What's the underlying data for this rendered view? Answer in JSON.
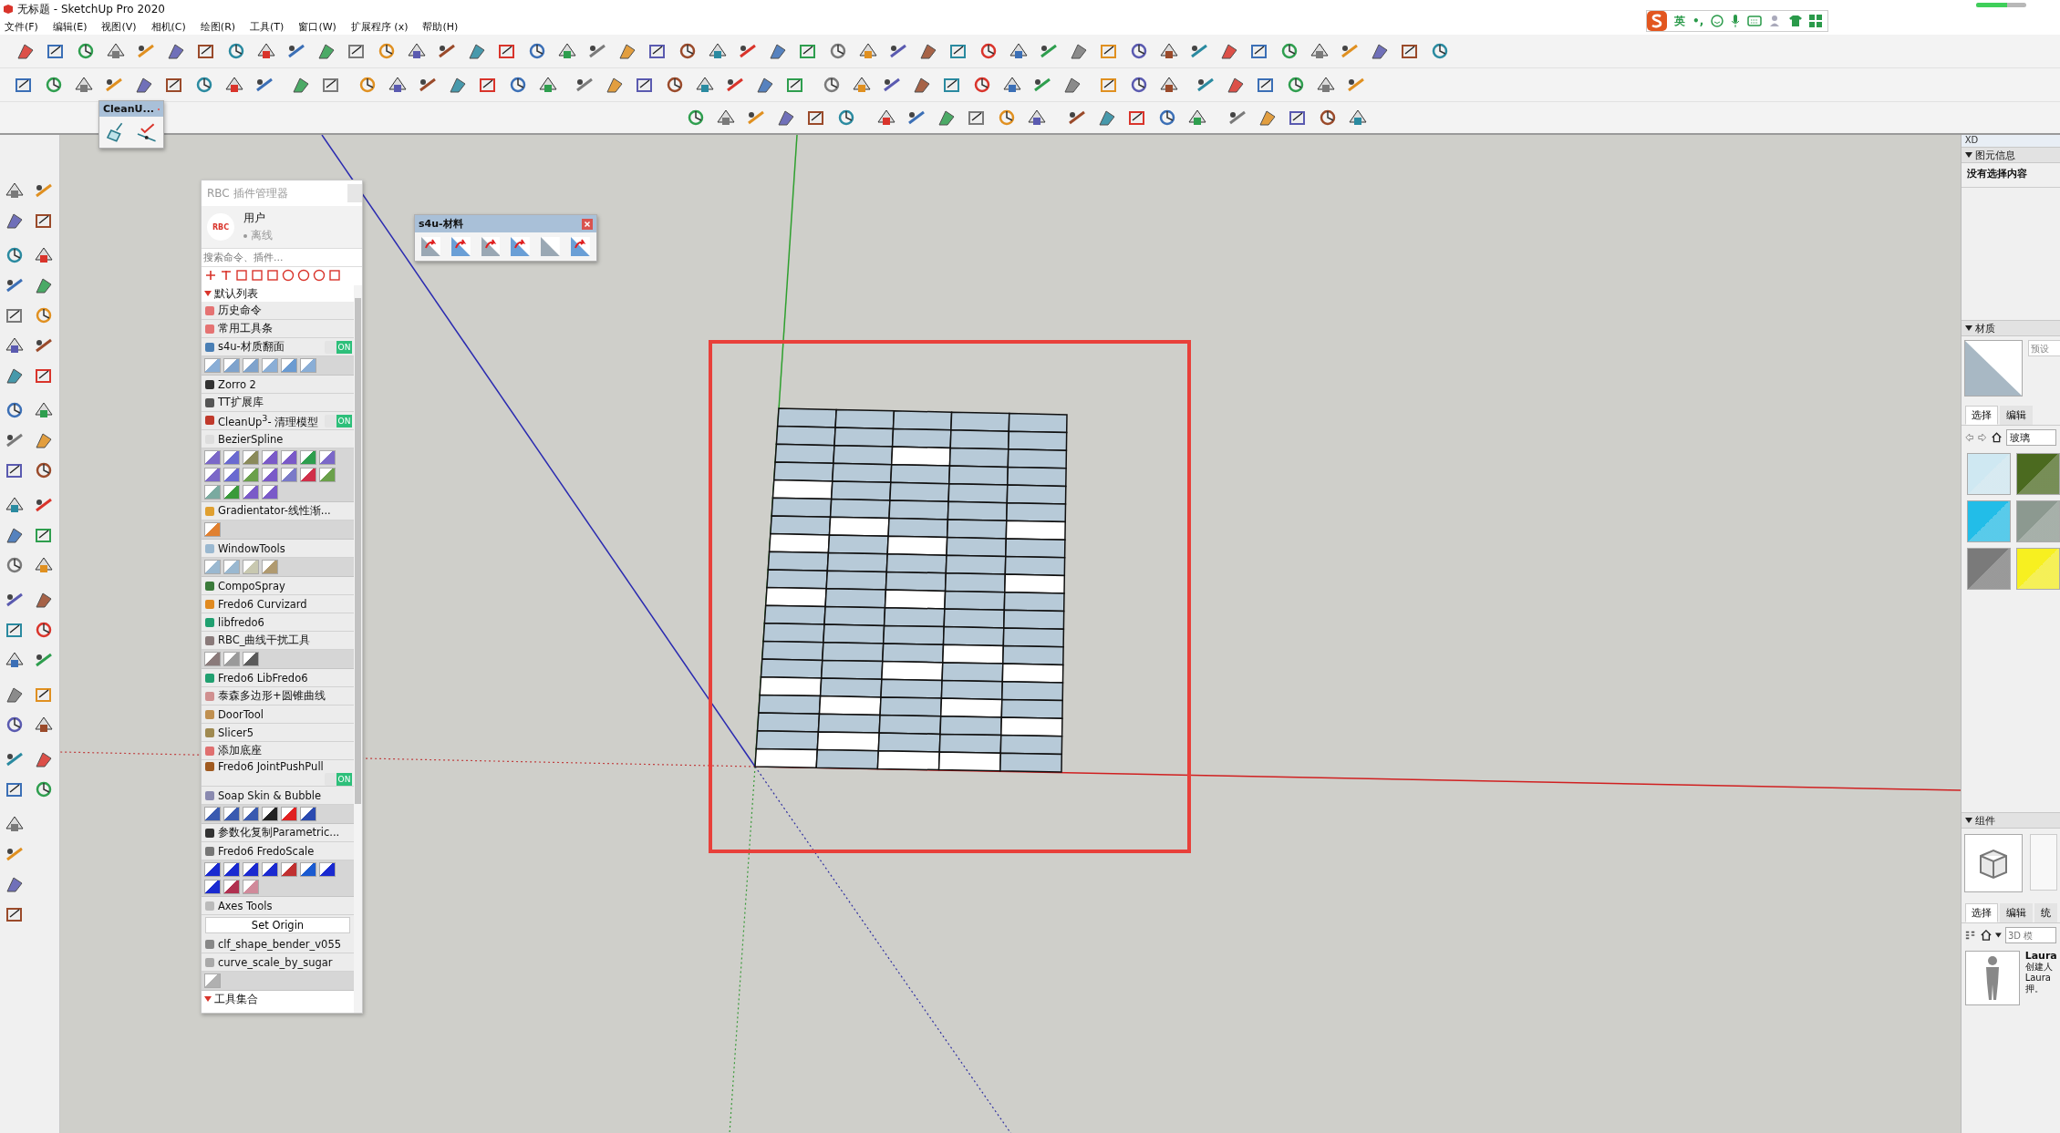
{
  "window": {
    "title": "无标题 - SketchUp Pro 2020"
  },
  "menu": [
    "文件(F)",
    "编辑(E)",
    "视图(V)",
    "相机(C)",
    "绘图(R)",
    "工具(T)",
    "窗口(W)",
    "扩展程序 (x)",
    "帮助(H)"
  ],
  "ime_bar": {
    "label": "英",
    "punct": "•,"
  },
  "status_meter": {
    "level": 0.62
  },
  "cleanup_toolbar": {
    "title": "CleanU..."
  },
  "s4u_toolbar": {
    "title": "s4u-材料"
  },
  "plugin_manager": {
    "title": "RBC 插件管理器",
    "logo": "RBC",
    "user": "用户",
    "status": "离线",
    "search": {
      "placeholder": "搜索命令、插件..."
    },
    "sections": [
      {
        "label": "默认列表",
        "expanded": true,
        "items": [
          {
            "kind": "plugin",
            "label": "历史命令",
            "color": "#e57373"
          },
          {
            "kind": "plugin",
            "label": "常用工具条",
            "color": "#e57373"
          },
          {
            "kind": "plugin",
            "label": "s4u-材质翻面",
            "color": "#4a7fb5",
            "toggle": {
              "on": true,
              "text": "ON"
            }
          },
          {
            "kind": "icons",
            "icons": [
              {
                "color": "#8aaed6"
              },
              {
                "color": "#7fa3cc"
              },
              {
                "color": "#7fa3cc"
              },
              {
                "color": "#8aaed6"
              },
              {
                "color": "#6b9bd1"
              },
              {
                "color": "#8aaed6"
              }
            ]
          },
          {
            "kind": "plugin",
            "label": "Zorro 2",
            "color": "#333333"
          },
          {
            "kind": "plugin",
            "label": "TT扩展库",
            "color": "#555555"
          },
          {
            "kind": "plugin",
            "label": "CleanUp$^{3}$- 清理模型",
            "color": "#c0392b",
            "toggle": {
              "on": true,
              "text": "ON"
            }
          },
          {
            "kind": "plugin",
            "label": "BezierSpline",
            "color": "#dddddd"
          },
          {
            "kind": "icons",
            "icons": [
              {
                "color": "#7b68c8"
              },
              {
                "color": "#6a6ad0"
              },
              {
                "color": "#8a8a5a"
              },
              {
                "color": "#7a5ac8"
              },
              {
                "color": "#7a5ac8"
              },
              {
                "color": "#2e9e4e"
              },
              {
                "color": "#7b68c8"
              },
              {
                "color": "#7b68c8"
              },
              {
                "color": "#6a6ad0"
              },
              {
                "color": "#6aa04a"
              },
              {
                "color": "#7a5ac8"
              },
              {
                "color": "#7a7ac8"
              },
              {
                "color": "#d0304a"
              },
              {
                "color": "#6aa04a"
              },
              {
                "color": "#7aaaa0"
              },
              {
                "color": "#3a9a3a"
              },
              {
                "color": "#7a5ac8"
              },
              {
                "color": "#7a5ac8"
              }
            ]
          },
          {
            "kind": "plugin",
            "label": "Gradientator-线性渐...",
            "color": "#e0a030"
          },
          {
            "kind": "icons",
            "icons": [
              {
                "color": "#e08030"
              }
            ]
          },
          {
            "kind": "plugin",
            "label": "WindowTools",
            "color": "#9ab8d0"
          },
          {
            "kind": "icons",
            "icons": [
              {
                "color": "#9ab8d0"
              },
              {
                "color": "#9ab8d0"
              },
              {
                "color": "#c8c8b0"
              },
              {
                "color": "#b09a70"
              }
            ]
          },
          {
            "kind": "plugin",
            "label": "CompoSpray",
            "color": "#3a7a3a"
          },
          {
            "kind": "plugin",
            "label": "Fredo6 Curvizard",
            "color": "#e08a20"
          },
          {
            "kind": "plugin",
            "label": "libfredo6",
            "color": "#20a070"
          },
          {
            "kind": "plugin",
            "label": "RBC_曲线干扰工具",
            "color": "#8a7a7a"
          },
          {
            "kind": "icons",
            "icons": [
              {
                "color": "#8a7a7a"
              },
              {
                "color": "#9a9a9a"
              },
              {
                "color": "#5a5a5a"
              }
            ]
          },
          {
            "kind": "plugin",
            "label": "Fredo6 LibFredo6",
            "color": "#20a070"
          },
          {
            "kind": "plugin",
            "label": "泰森多边形+圆锥曲线",
            "color": "#d09090"
          },
          {
            "kind": "plugin",
            "label": "DoorTool",
            "color": "#c09050"
          },
          {
            "kind": "plugin",
            "label": "Slicer5",
            "color": "#a08a50"
          },
          {
            "kind": "plugin",
            "label": "添加底座",
            "color": "#e07070"
          },
          {
            "kind": "plugin",
            "label": "Fredo6 JointPushPull",
            "color": "#a05a20",
            "toggle": {
              "on": true,
              "text": "ON"
            }
          },
          {
            "kind": "plugin",
            "label": "Soap Skin & Bubble",
            "color": "#8a8ab0"
          },
          {
            "kind": "icons",
            "icons": [
              {
                "color": "#3a5ab0"
              },
              {
                "color": "#3a5ab0"
              },
              {
                "color": "#3a5ab0"
              },
              {
                "color": "#222222"
              },
              {
                "color": "#e02020"
              },
              {
                "color": "#2a4ab0"
              }
            ]
          },
          {
            "kind": "plugin",
            "label": "参数化复制Parametric...",
            "color": "#333333"
          },
          {
            "kind": "plugin",
            "label": "Fredo6 FredoScale",
            "color": "#777777"
          },
          {
            "kind": "icons",
            "icons": [
              {
                "color": "#1a2ad0"
              },
              {
                "color": "#1a2ad0"
              },
              {
                "color": "#1a2ad0"
              },
              {
                "color": "#1a2ad0"
              },
              {
                "color": "#c03030"
              },
              {
                "color": "#1a5ad0"
              },
              {
                "color": "#1a2ad0"
              },
              {
                "color": "#1a2ad0"
              },
              {
                "color": "#b03050"
              },
              {
                "color": "#d08a9a"
              }
            ]
          },
          {
            "kind": "plugin",
            "label": "Axes Tools",
            "color": "#bbbbbb"
          },
          {
            "kind": "button",
            "label": "Set Origin"
          },
          {
            "kind": "plugin",
            "label": "clf_shape_bender_v055",
            "color": "#888888"
          },
          {
            "kind": "plugin",
            "label": "curve_scale_by_sugar",
            "color": "#aaaaaa"
          },
          {
            "kind": "icons",
            "icons": [
              {
                "color": "#b0b0b0"
              }
            ]
          }
        ]
      },
      {
        "label": "工具集合",
        "expanded": true
      }
    ]
  },
  "tray": {
    "title": "XD",
    "entity_info": {
      "label": "图元信息",
      "expanded": true,
      "message": "没有选择内容"
    },
    "materials": {
      "label": "材质",
      "expanded": true,
      "name_placeholder": "预设",
      "tabs": [
        {
          "label": "选择",
          "selected": true
        },
        {
          "label": "编辑",
          "selected": false
        }
      ],
      "library": "玻璃",
      "swatches": [
        {
          "color": "#cfe8f2"
        },
        {
          "color": "#4b6a1f"
        },
        {
          "color": "#22bde8"
        },
        {
          "color": "#8c9990"
        },
        {
          "color": "#7a7a7a"
        },
        {
          "color": "#f7f020"
        }
      ]
    },
    "components": {
      "label": "组件",
      "expanded": true,
      "tabs": [
        {
          "label": "选择",
          "selected": true
        },
        {
          "label": "编辑",
          "selected": false
        },
        {
          "label": "统",
          "selected": false
        }
      ],
      "search_placeholder": "3D 模",
      "items": [
        {
          "name": "Laura",
          "lines": [
            "创建人",
            "Laura",
            "押。"
          ]
        }
      ]
    }
  }
}
